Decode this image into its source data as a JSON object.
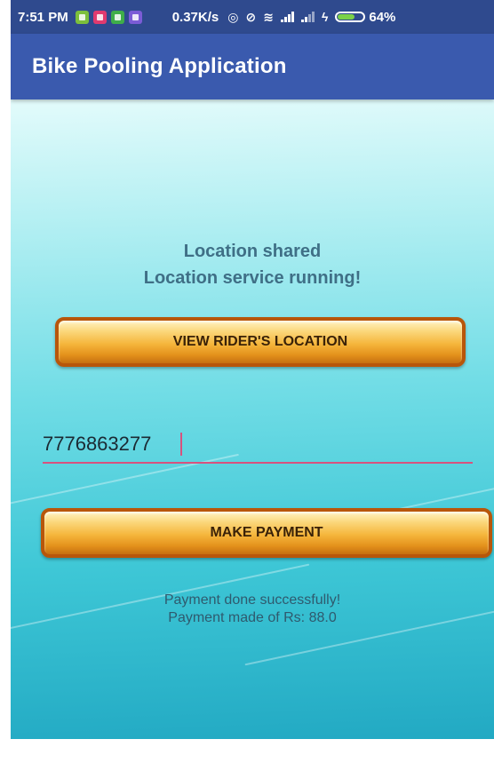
{
  "status_bar": {
    "time": "7:51 PM",
    "speed": "0.37K/s",
    "battery_percent": "64%",
    "notification_icons": [
      "app-icon",
      "mail-icon",
      "lock-icon",
      "image-icon"
    ],
    "notification_colors": [
      "#7cbf3c",
      "#e03a6f",
      "#3fae49",
      "#7b5cd6"
    ],
    "system_icons": [
      "hotspot-icon",
      "mute-icon",
      "wifi-icon",
      "signal-icon",
      "signal-icon",
      "charging-icon",
      "battery-icon"
    ]
  },
  "appbar": {
    "title": "Bike Pooling Application",
    "color": "#3a5aae"
  },
  "main": {
    "location_line1": "Location shared",
    "location_line2": "Location service running!",
    "view_location_button": "VIEW RIDER'S LOCATION",
    "phone_value": "7776863277",
    "phone_placeholder": "",
    "make_payment_button": "MAKE PAYMENT",
    "payment_line1": "Payment done successfully!",
    "payment_line2": "Payment made of Rs: 88.0"
  },
  "colors": {
    "accent_underline": "#d8527e",
    "button_gold": "#f5b53b",
    "text_teal": "#3f6f86"
  }
}
